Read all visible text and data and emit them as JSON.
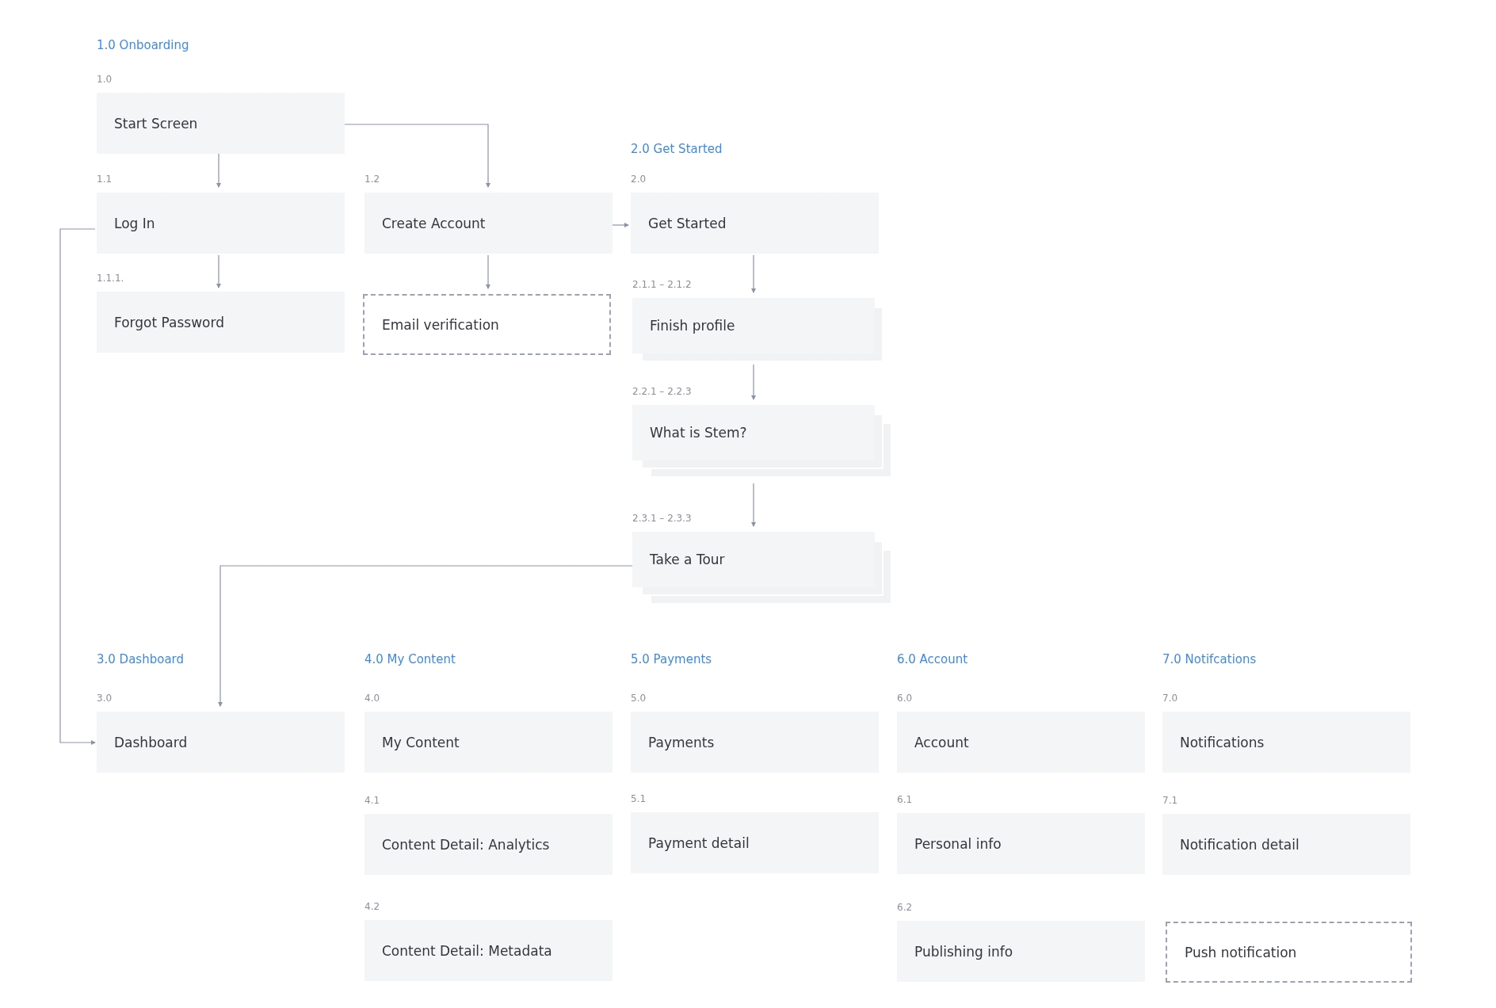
{
  "sections": [
    {
      "title": "1.0 Onboarding"
    },
    {
      "title": "2.0 Get Started"
    },
    {
      "title": "3.0 Dashboard"
    },
    {
      "title": "4.0 My Content"
    },
    {
      "title": "5.0 Payments"
    },
    {
      "title": "6.0 Account"
    },
    {
      "title": "7.0 Notifcations"
    }
  ],
  "nodes": [
    {
      "number": "1.0",
      "label": "Start Screen",
      "kind": "screen"
    },
    {
      "number": "1.1",
      "label": "Log In",
      "kind": "screen"
    },
    {
      "number": "1.2",
      "label": "Create Account",
      "kind": "screen"
    },
    {
      "number": "1.1.1.",
      "label": "Forgot Password",
      "kind": "screen"
    },
    {
      "label": "Email verification",
      "kind": "dashed"
    },
    {
      "number": "2.0",
      "label": "Get Started",
      "kind": "screen"
    },
    {
      "number": "2.1.1 – 2.1.2",
      "label": "Finish profile",
      "kind": "stack2"
    },
    {
      "number": "2.2.1 – 2.2.3",
      "label": "What is Stem?",
      "kind": "stack3"
    },
    {
      "number": "2.3.1 – 2.3.3",
      "label": "Take a Tour",
      "kind": "stack3"
    },
    {
      "number": "3.0",
      "label": "Dashboard",
      "kind": "screen"
    },
    {
      "number": "4.0",
      "label": "My Content",
      "kind": "screen"
    },
    {
      "number": "4.1",
      "label": "Content Detail: Analytics",
      "kind": "screen"
    },
    {
      "number": "4.2",
      "label": "Content Detail: Metadata",
      "kind": "screen"
    },
    {
      "number": "5.0",
      "label": "Payments",
      "kind": "screen"
    },
    {
      "number": "5.1",
      "label": "Payment detail",
      "kind": "screen"
    },
    {
      "number": "6.0",
      "label": "Account",
      "kind": "screen"
    },
    {
      "number": "6.1",
      "label": "Personal info",
      "kind": "screen"
    },
    {
      "number": "6.2",
      "label": "Publishing info",
      "kind": "screen"
    },
    {
      "number": "7.0",
      "label": "Notifications",
      "kind": "screen"
    },
    {
      "number": "7.1",
      "label": "Notification detail",
      "kind": "screen"
    },
    {
      "label": "Push notification",
      "kind": "dashed"
    }
  ]
}
